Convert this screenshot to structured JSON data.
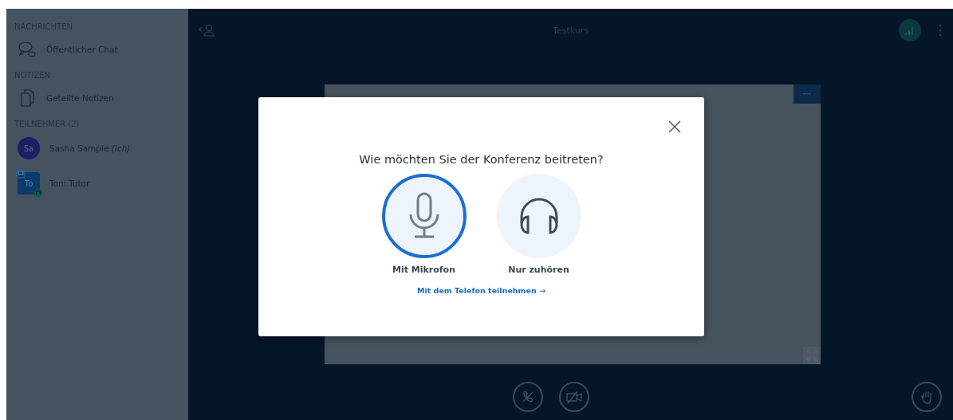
{
  "sidebar": {
    "sections": [
      {
        "heading": "NACHRICHTEN",
        "items": [
          {
            "kind": "chat",
            "label": "Öffentlicher Chat"
          }
        ]
      },
      {
        "heading": "NOTIZEN",
        "items": [
          {
            "kind": "notes",
            "label": "Geteilte Notizen"
          }
        ]
      },
      {
        "heading": "TEILNEHMER (2)",
        "items": [
          {
            "kind": "viewer",
            "avatar": "Sa",
            "label": "Sasha Sample *(Ich)*",
            "color": "#1c2062"
          },
          {
            "kind": "moderator",
            "avatar": "To",
            "label": "Toni Tutor",
            "color": "#0b3a6b"
          }
        ]
      }
    ]
  },
  "topbar": {
    "title": "Testkurs"
  },
  "modal": {
    "title": "Wie möchten Sie der Konferenz beitreten?",
    "options": [
      {
        "kind": "microphone",
        "label": "Mit Mikrofon",
        "selected": true
      },
      {
        "kind": "listen",
        "label": "Nur zuhören",
        "selected": false
      }
    ],
    "phone_link": "Mit dem Telefon teilnehmen →"
  }
}
